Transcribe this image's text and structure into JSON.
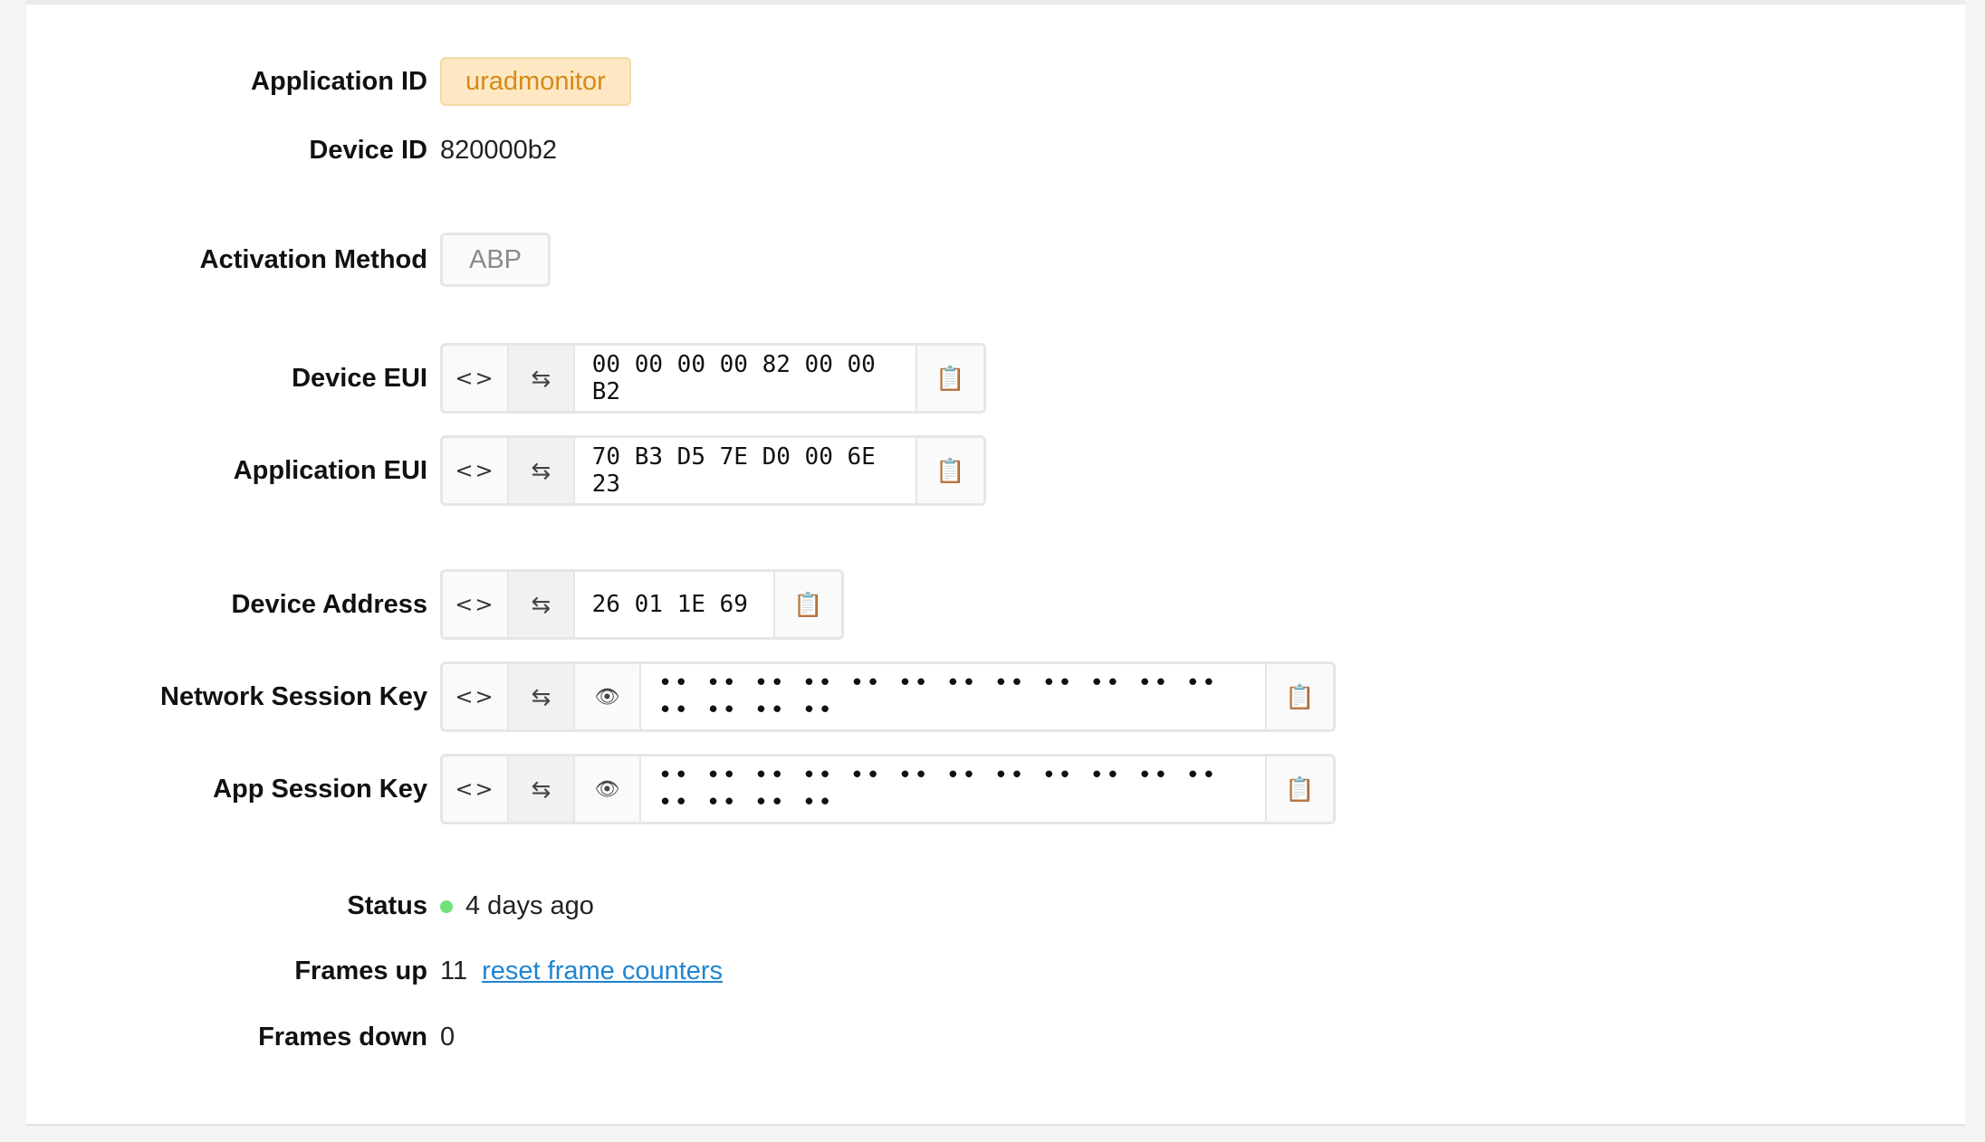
{
  "fields": {
    "application_id": {
      "label": "Application ID",
      "value": "uradmonitor"
    },
    "device_id": {
      "label": "Device ID",
      "value": "820000b2"
    },
    "activation_method": {
      "label": "Activation Method",
      "value": "ABP"
    },
    "device_eui": {
      "label": "Device EUI",
      "value": "00 00 00 00 82 00 00 B2"
    },
    "application_eui": {
      "label": "Application EUI",
      "value": "70 B3 D5 7E D0 00 6E 23"
    },
    "device_address": {
      "label": "Device Address",
      "value": "26 01 1E 69"
    },
    "network_session_key": {
      "label": "Network Session Key",
      "value": "•• •• •• •• •• •• •• •• •• •• •• •• •• •• •• ••"
    },
    "app_session_key": {
      "label": "App Session Key",
      "value": "•• •• •• •• •• •• •• •• •• •• •• •• •• •• •• ••"
    },
    "status": {
      "label": "Status",
      "value": "4 days ago",
      "dot_color": "#6fe27a"
    },
    "frames_up": {
      "label": "Frames up",
      "value": "11",
      "link": "reset frame counters"
    },
    "frames_down": {
      "label": "Frames down",
      "value": "0"
    }
  },
  "icons": {
    "format_toggle": "code-brackets-icon",
    "byte_order": "swap-arrows-icon",
    "reveal": "eye-icon",
    "copy": "clipboard-icon"
  },
  "colors": {
    "app_tag_bg": "#fde8c3",
    "app_tag_text": "#d68a19",
    "link": "#1f85d0"
  }
}
